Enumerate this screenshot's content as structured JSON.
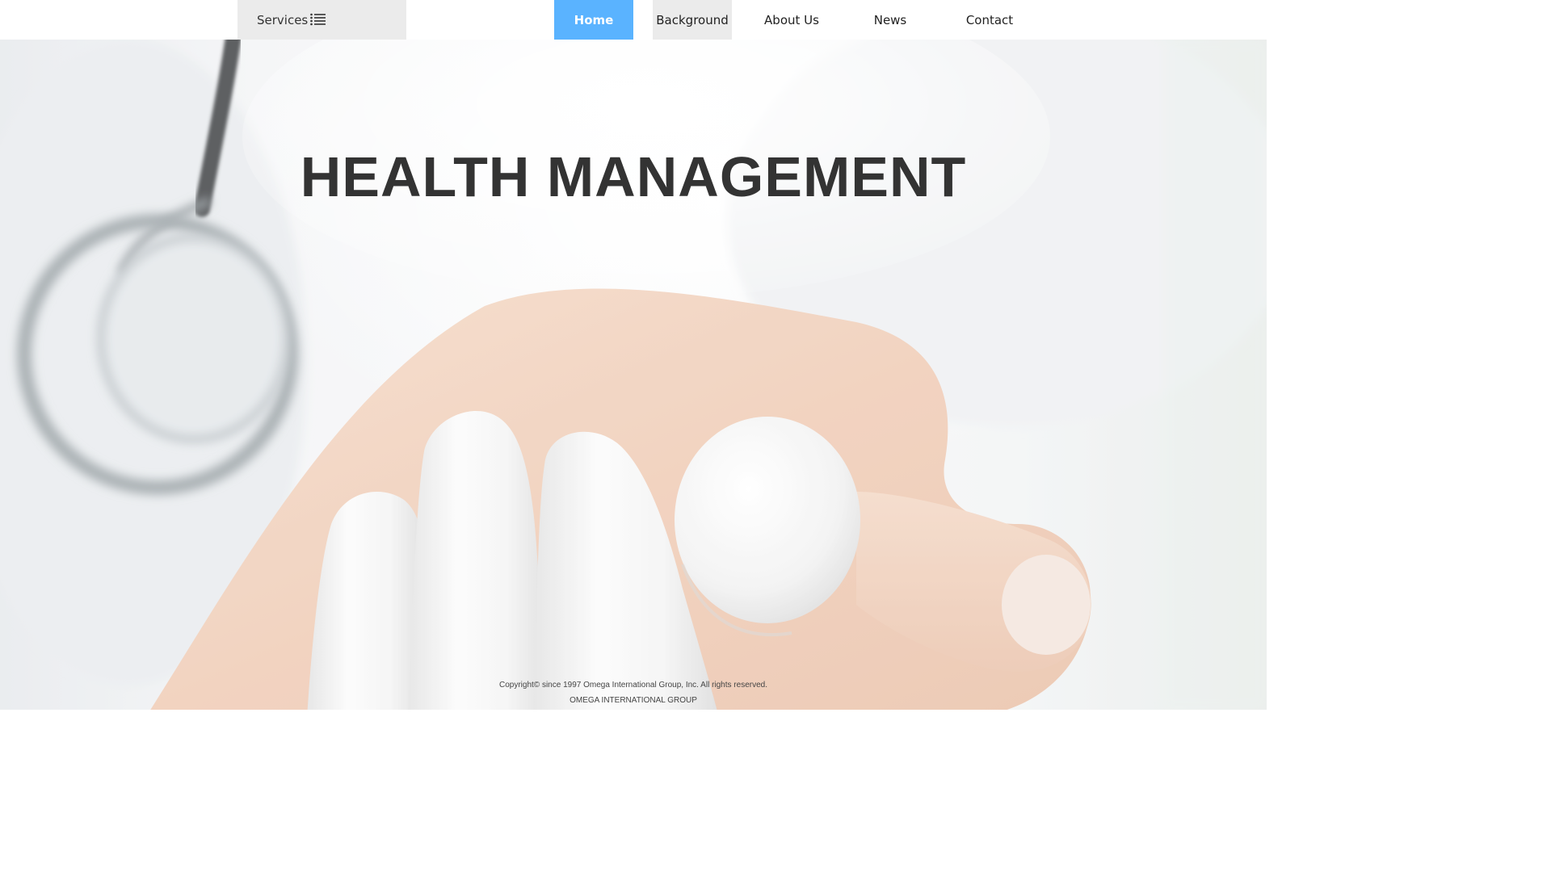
{
  "nav": {
    "services_label": "Services",
    "items": [
      {
        "label": "Home",
        "active": true
      },
      {
        "label": "Background"
      },
      {
        "label": "About Us"
      },
      {
        "label": "News"
      },
      {
        "label": "Contact"
      }
    ]
  },
  "hero": {
    "title": "HEALTH MANAGEMENT"
  },
  "footer": {
    "copyright": "Copyright© since 1997 Omega International Group, Inc. All rights reserved.",
    "company": "OMEGA INTERNATIONAL GROUP"
  },
  "colors": {
    "accent": "#5ab3ff",
    "nav_highlight": "#ebebeb",
    "title_text": "#333333"
  },
  "icons": {
    "services": "list-icon"
  }
}
